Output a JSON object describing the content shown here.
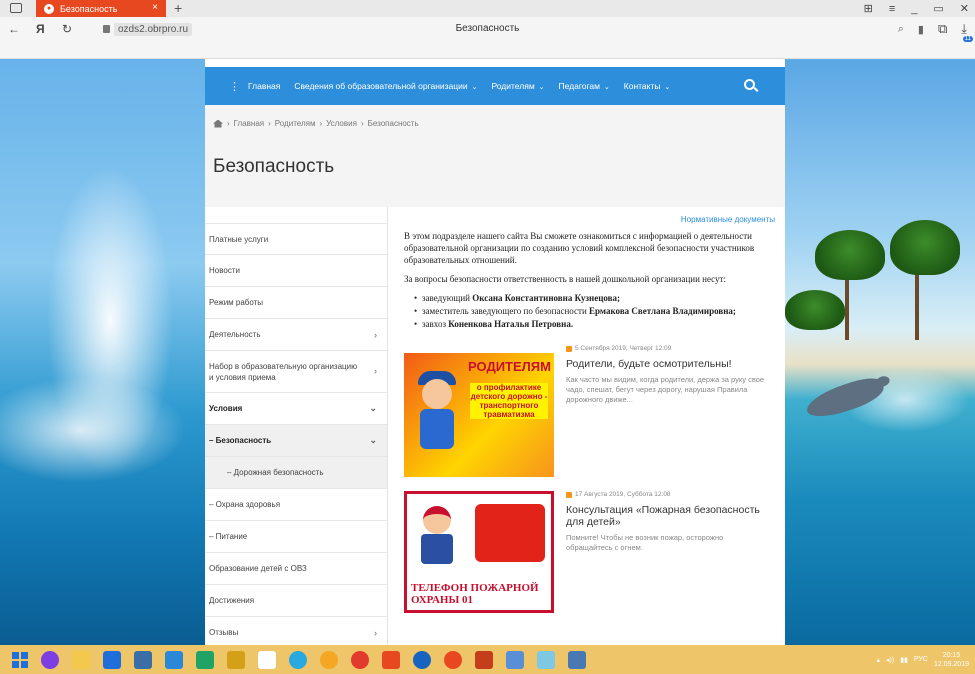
{
  "browser": {
    "tab_title": "Безопасность",
    "tab_close": "×",
    "new_tab": "+",
    "url": "ozds2.obrpro.ru",
    "page_title": "Безопасность",
    "download_count": "11"
  },
  "site": {
    "nav": [
      {
        "label": "Главная",
        "caret": false
      },
      {
        "label": "Сведения об образовательной организации",
        "caret": true
      },
      {
        "label": "Родителям",
        "caret": true
      },
      {
        "label": "Педагогам",
        "caret": true
      },
      {
        "label": "Контакты",
        "caret": true
      }
    ],
    "breadcrumb": [
      "Главная",
      "Родителям",
      "Условия",
      "Безопасность"
    ],
    "breadcrumb_sep": "›",
    "title": "Безопасность",
    "sidebar": [
      {
        "label": "Платные услуги",
        "arrow": ""
      },
      {
        "label": "Новости",
        "arrow": ""
      },
      {
        "label": "Режим работы",
        "arrow": ""
      },
      {
        "label": "Деятельность",
        "arrow": "›"
      },
      {
        "label": "Набор в образовательную организацию и условия приема",
        "arrow": "›"
      },
      {
        "label": "Условия",
        "arrow": "⌄"
      },
      {
        "label": "– Безопасность",
        "arrow": "⌄"
      },
      {
        "label": "– Дорожная безопасность",
        "arrow": ""
      },
      {
        "label": "– Охрана здоровья",
        "arrow": ""
      },
      {
        "label": "– Питание",
        "arrow": ""
      },
      {
        "label": "Образование детей с ОВЗ",
        "arrow": ""
      },
      {
        "label": "Достижения",
        "arrow": ""
      },
      {
        "label": "Отзывы",
        "arrow": "›"
      }
    ],
    "docs_link": "Нормативные документы",
    "intro": "В этом подразделе нашего сайта Вы сможете ознакомиться с информацией о деятельности образовательной организации по созданию условий комплексной безопасности участников образовательных отношений.",
    "responsibility": "За вопросы безопасности ответственность в нашей дошкольной организации несут:",
    "staff": [
      {
        "role": "заведующий",
        "name": "Оксана Константиновна Кузнецова;"
      },
      {
        "role": "заместитель заведующего по безопасности",
        "name": "Ермакова Светлана Владимировна;"
      },
      {
        "role": "завхоз",
        "name": "Коненкова Наталья Петровна."
      }
    ],
    "news": [
      {
        "date": "5 Сентября 2019, Четверг 12:09",
        "title": "Родители, будьте осмотрительны!",
        "text": "Как часто мы видим, когда родители, держа за руку свое чадо, спешат, бегут через дорогу, нарушая Правила дорожного движе...",
        "image_title": "РОДИТЕЛЯМ",
        "image_sub": "о профилактике детского дорожно - транспортного травматизма"
      },
      {
        "date": "17 Августа 2019, Суббота 12:08",
        "title": "Консультация «Пожарная безопасность для детей»",
        "text": "Помните! Чтобы не возник пожар, осторожно обращайтесь с огнем.",
        "image_title": "ТЕЛЕФОН ПОЖАРНОЙ ОХРАНЫ 01"
      }
    ]
  },
  "taskbar": {
    "lang": "РУС",
    "time": "20:15",
    "date": "12.09.2019"
  },
  "colors": {
    "nav_blue": "#2d8fdc",
    "tab_orange": "#e8481f",
    "taskbar": "#efc56a"
  }
}
